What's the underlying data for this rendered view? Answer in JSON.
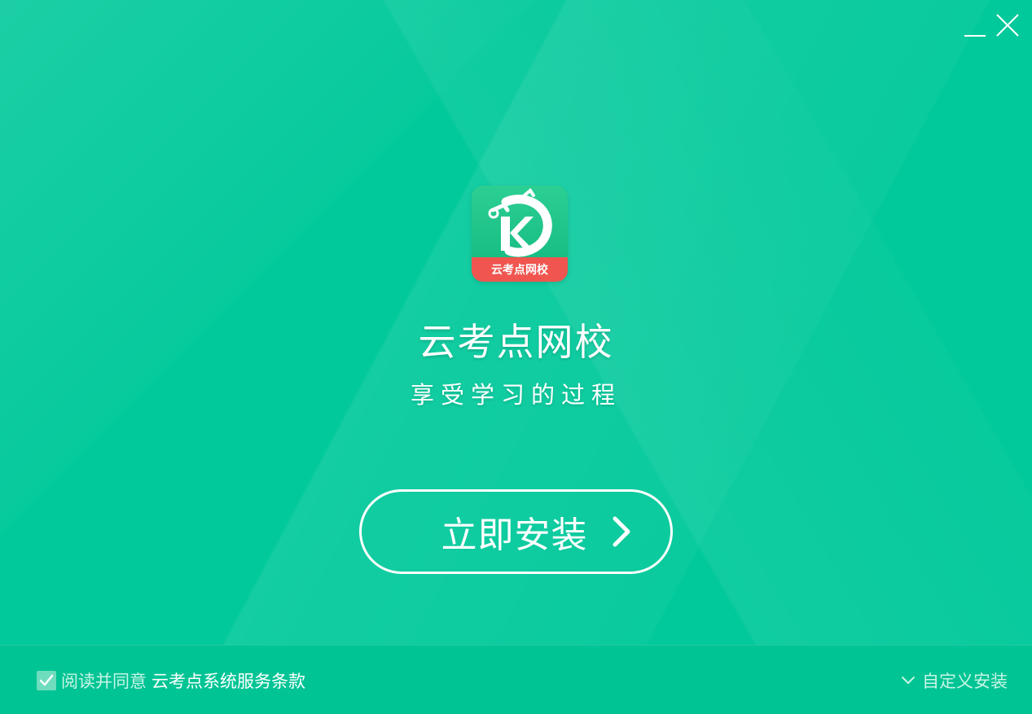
{
  "window": {
    "minimize_label": "minimize",
    "close_label": "close"
  },
  "logo": {
    "ribbon_text": "云考点网校",
    "letter": "K",
    "icon": "app-logo-icon"
  },
  "app": {
    "title": "云考点网校",
    "slogan": "享受学习的过程"
  },
  "install": {
    "label": "立即安装",
    "icon": "chevron-right-icon"
  },
  "footer": {
    "agree_text": "阅读并同意",
    "terms_link": "云考点系统服务条款",
    "custom_install": "自定义安装",
    "agreed": true
  },
  "colors": {
    "background": "#02c99b",
    "ribbon": "#f0554f",
    "text": "#ffffff"
  }
}
